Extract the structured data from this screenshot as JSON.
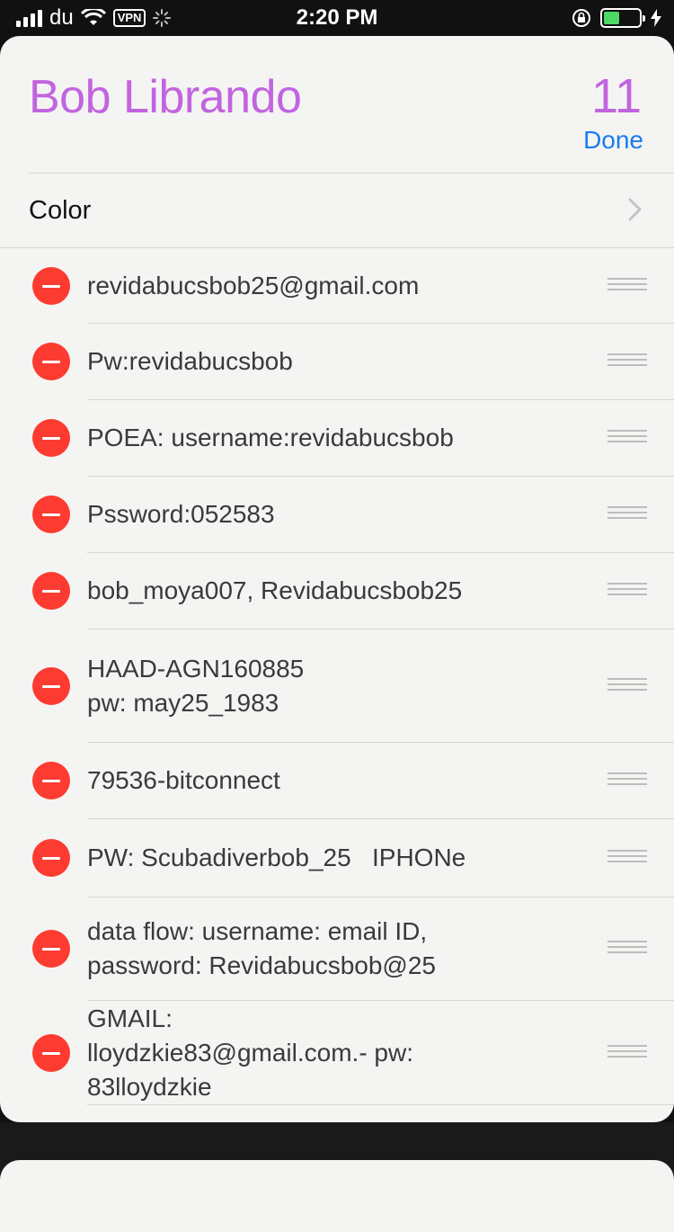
{
  "status_bar": {
    "carrier": "du",
    "vpn_label": "VPN",
    "time": "2:20 PM"
  },
  "header": {
    "title": "Bob Librando",
    "count": "11",
    "done_label": "Done"
  },
  "color_row": {
    "label": "Color"
  },
  "items": [
    {
      "text": "revidabucsbob25@gmail.com"
    },
    {
      "text": "Pw:revidabucsbob"
    },
    {
      "text": "POEA: username:revidabucsbob"
    },
    {
      "text": "Pssword:052583"
    },
    {
      "text": "bob_moya007, Revidabucsbob25"
    },
    {
      "text": "HAAD-AGN160885 pw: may25_1983"
    },
    {
      "text": "79536-bitconnect"
    },
    {
      "text": "PW: Scubadiverbob_25   IPHONe"
    },
    {
      "text": "data flow: username: email ID, password: Revidabucsbob@25"
    },
    {
      "text": "GMAIL: lloydzkie83@gmail.com.- pw: 83lloydzkie"
    }
  ],
  "colors": {
    "accent": "#c264e0",
    "done": "#1a7cf0",
    "delete": "#fd3b30"
  }
}
